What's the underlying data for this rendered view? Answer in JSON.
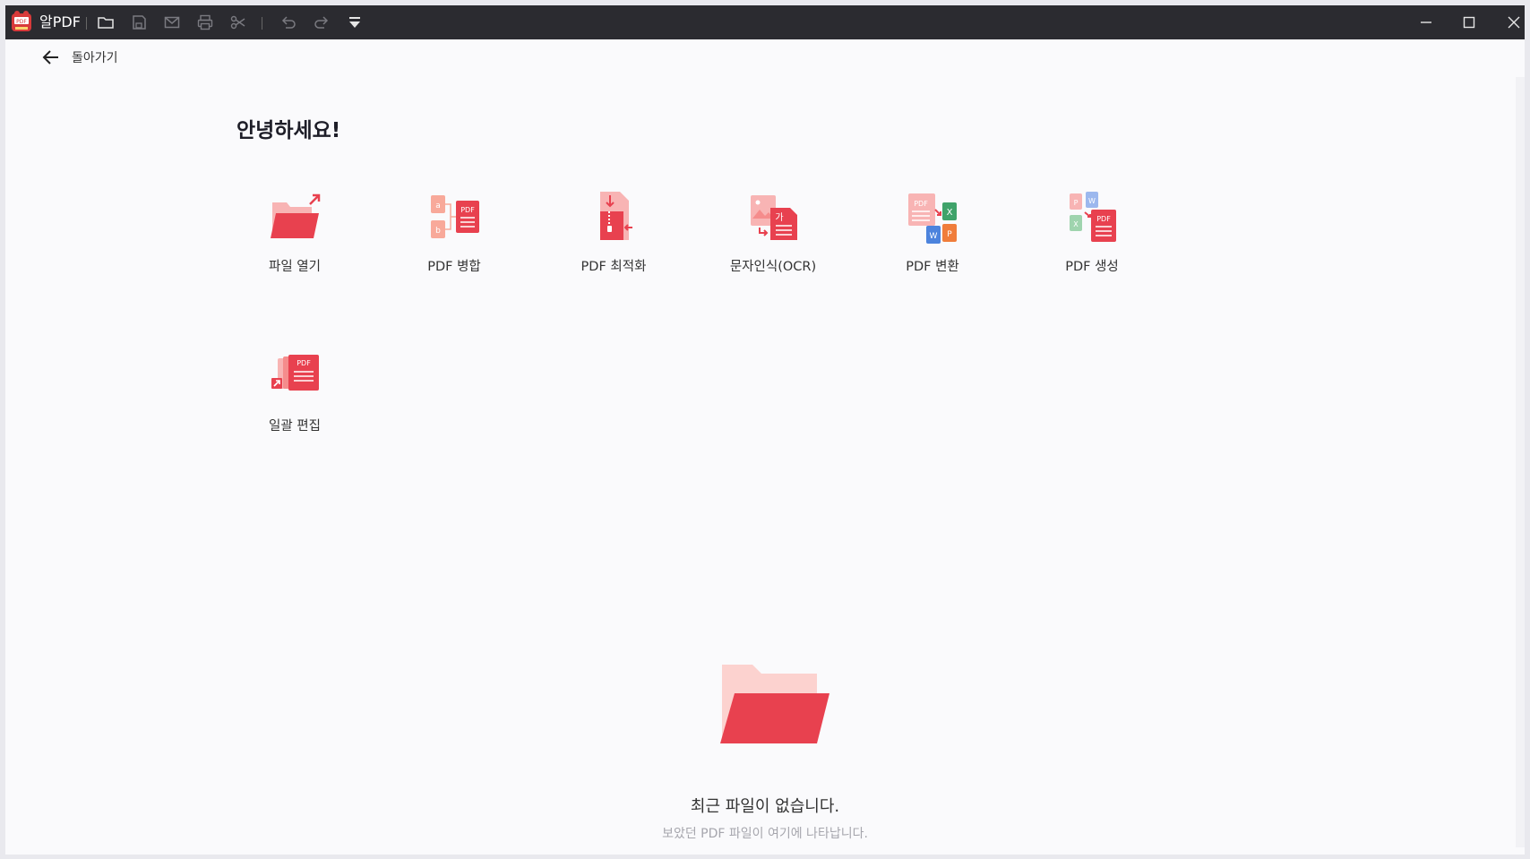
{
  "app": {
    "name": "알PDF"
  },
  "toolbar": {
    "icons": [
      "folder-icon",
      "save-icon",
      "mail-icon",
      "print-icon",
      "scissors-icon",
      "undo-icon",
      "redo-icon",
      "dropdown-icon"
    ]
  },
  "window_controls": [
    "minimize-icon",
    "maximize-icon",
    "close-icon"
  ],
  "nav": {
    "back_label": "돌아가기"
  },
  "main": {
    "greeting": "안녕하세요!",
    "tools": [
      {
        "label": "파일 열기",
        "icon": "folder-open-icon"
      },
      {
        "label": "PDF 병합",
        "icon": "pdf-merge-icon"
      },
      {
        "label": "PDF 최적화",
        "icon": "pdf-optimize-icon"
      },
      {
        "label": "문자인식(OCR)",
        "icon": "ocr-icon"
      },
      {
        "label": "PDF 변환",
        "icon": "pdf-convert-icon"
      },
      {
        "label": "PDF 생성",
        "icon": "pdf-create-icon"
      },
      {
        "label": "일괄 편집",
        "icon": "batch-edit-icon"
      }
    ]
  },
  "recent": {
    "empty_title": "최근 파일이 없습니다.",
    "empty_subtitle": "보았던 PDF 파일이 여기에 나타납니다."
  },
  "colors": {
    "titlebar": "#2b2b30",
    "accent_red": "#e8414f",
    "accent_pink": "#f8b4b4",
    "background": "#fafafc"
  }
}
